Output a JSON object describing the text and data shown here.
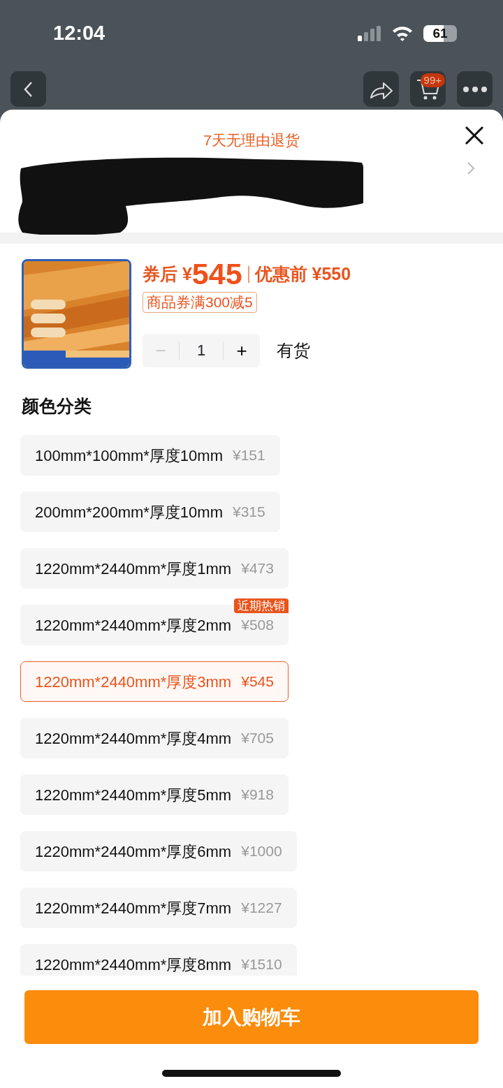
{
  "status_bar": {
    "time": "12:04",
    "battery": "61"
  },
  "nav": {
    "cart_badge": "99+"
  },
  "sheet": {
    "title": "7天无理由退货"
  },
  "product": {
    "price_label": "券后 ¥",
    "price": "545",
    "original_price": "优惠前 ¥550",
    "coupon": "商品券满300减5",
    "stock": "有货",
    "stepper": {
      "minus": {
        "label": "−",
        "disabled": true
      },
      "quantity": "1",
      "plus": {
        "label": "+",
        "disabled": false
      }
    }
  },
  "section_title": "颜色分类",
  "options": [
    {
      "label": "100mm*100mm*厚度10mm",
      "price": "¥151",
      "selected": false
    },
    {
      "label": "200mm*200mm*厚度10mm",
      "price": "¥315",
      "selected": false
    },
    {
      "label": "1220mm*2440mm*厚度1mm",
      "price": "¥473",
      "selected": false
    },
    {
      "label": "1220mm*2440mm*厚度2mm",
      "price": "¥508",
      "selected": false,
      "badge": "近期热销"
    },
    {
      "label": "1220mm*2440mm*厚度3mm",
      "price": "¥545",
      "selected": true
    },
    {
      "label": "1220mm*2440mm*厚度4mm",
      "price": "¥705",
      "selected": false
    },
    {
      "label": "1220mm*2440mm*厚度5mm",
      "price": "¥918",
      "selected": false
    },
    {
      "label": "1220mm*2440mm*厚度6mm",
      "price": "¥1000",
      "selected": false
    },
    {
      "label": "1220mm*2440mm*厚度7mm",
      "price": "¥1227",
      "selected": false
    },
    {
      "label": "1220mm*2440mm*厚度8mm",
      "price": "¥1510",
      "selected": false
    }
  ],
  "add_to_cart": "加入购物车"
}
